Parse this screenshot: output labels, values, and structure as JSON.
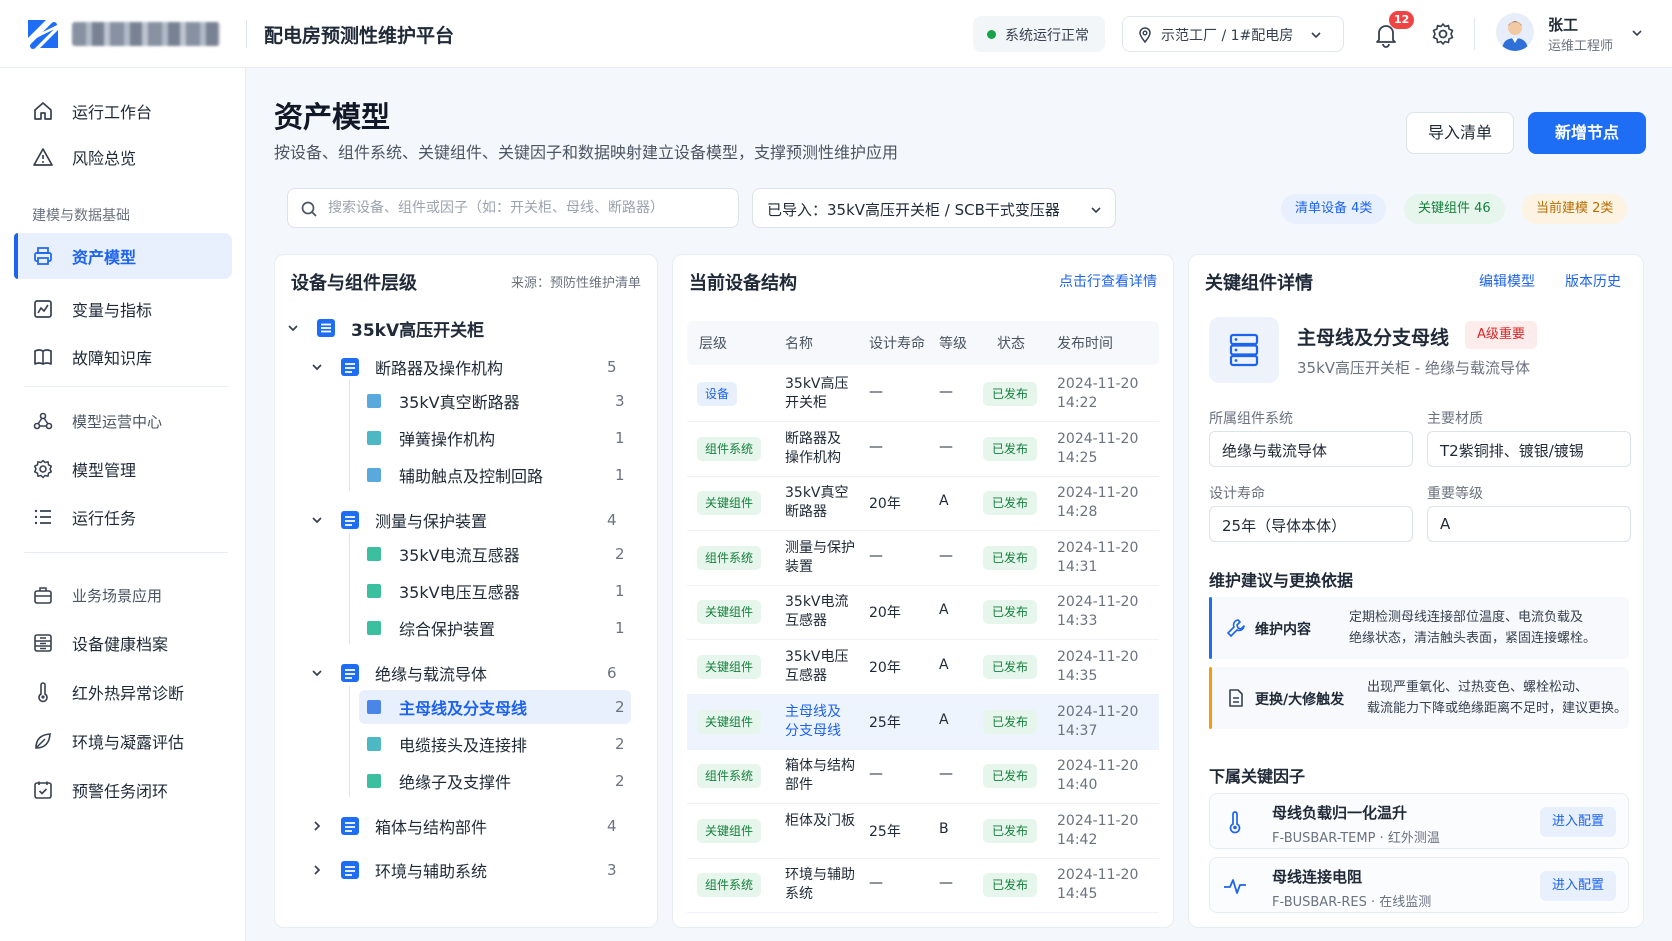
{
  "header": {
    "app_title": "配电房预测性维护平台",
    "system_status": "系统运行正常",
    "location": "示范工厂 / 1#配电房",
    "notifications": "12",
    "user_name": "张工",
    "user_role": "运维工程师"
  },
  "sidebar": {
    "items": [
      {
        "label": "运行工作台",
        "icon": "home-icon"
      },
      {
        "label": "风险总览",
        "icon": "warning-icon"
      },
      {
        "section": "建模与数据基础"
      },
      {
        "label": "资产模型",
        "icon": "printer-icon",
        "active": true
      },
      {
        "label": "变量与指标",
        "icon": "chart-icon"
      },
      {
        "label": "故障知识库",
        "icon": "book-icon"
      },
      {
        "section": "模型运营中心",
        "icon": "flow-icon"
      },
      {
        "label": "模型管理",
        "icon": "gear-icon"
      },
      {
        "label": "运行任务",
        "icon": "list-icon"
      },
      {
        "section": "业务场景应用",
        "icon": "briefcase-icon"
      },
      {
        "label": "设备健康档案",
        "icon": "archive-icon"
      },
      {
        "label": "红外热异常诊断",
        "icon": "thermometer-icon"
      },
      {
        "label": "环境与凝露评估",
        "icon": "leaf-icon"
      },
      {
        "label": "预警任务闭环",
        "icon": "calendar-check-icon"
      }
    ]
  },
  "page": {
    "title": "资产模型",
    "subtitle": "按设备、组件系统、关键组件、关键因子和数据映射建立设备模型，支撑预测性维护应用",
    "import_button": "导入清单",
    "add_button": "新增节点"
  },
  "filters": {
    "search_placeholder": "搜索设备、组件或因子（如：开关柜、母线、断路器）",
    "imported": "已导入：35kV高压开关柜 / SCB干式变压器",
    "chip_list": "清单设备 4类",
    "chip_key": "关键组件 46",
    "chip_model": "当前建模 2类"
  },
  "tree": {
    "title": "设备与组件层级",
    "source": "来源：预防性维护清单",
    "root": "35kV高压开关柜",
    "groups": [
      {
        "label": "断路器及操作机构",
        "count": "5",
        "expanded": true,
        "children": [
          {
            "label": "35kV真空断路器",
            "count": "3",
            "color": "#5aa9dd"
          },
          {
            "label": "弹簧操作机构",
            "count": "1",
            "color": "#4cb8c4"
          },
          {
            "label": "辅助触点及控制回路",
            "count": "1",
            "color": "#5aa9dd"
          }
        ]
      },
      {
        "label": "测量与保护装置",
        "count": "4",
        "expanded": true,
        "children": [
          {
            "label": "35kV电流互感器",
            "count": "2",
            "color": "#3cbf9e"
          },
          {
            "label": "35kV电压互感器",
            "count": "1",
            "color": "#3cbf9e"
          },
          {
            "label": "综合保护装置",
            "count": "1",
            "color": "#3cbf9e"
          }
        ]
      },
      {
        "label": "绝缘与载流导体",
        "count": "6",
        "expanded": true,
        "children": [
          {
            "label": "主母线及分支母线",
            "count": "2",
            "color": "#4a86e8",
            "selected": true
          },
          {
            "label": "电缆接头及连接排",
            "count": "2",
            "color": "#4cb8c4"
          },
          {
            "label": "绝缘子及支撑件",
            "count": "2",
            "color": "#3cbf9e"
          }
        ]
      },
      {
        "label": "箱体与结构部件",
        "count": "4",
        "expanded": false
      },
      {
        "label": "环境与辅助系统",
        "count": "3",
        "expanded": false
      }
    ]
  },
  "structure": {
    "title": "当前设备结构",
    "link": "点击行查看详情",
    "columns": [
      "层级",
      "名称",
      "设计寿命",
      "等级",
      "状态",
      "发布时间"
    ],
    "rows": [
      {
        "level": "设备",
        "kind": "dev",
        "name": [
          "35kV高压",
          "开关柜"
        ],
        "life": "—",
        "grade": "—",
        "status": "已发布",
        "date": "2024-11-20",
        "time": "14:22"
      },
      {
        "level": "组件系统",
        "kind": "sys",
        "name": [
          "断路器及",
          "操作机构"
        ],
        "life": "—",
        "grade": "—",
        "status": "已发布",
        "date": "2024-11-20",
        "time": "14:25"
      },
      {
        "level": "关键组件",
        "kind": "key",
        "name": [
          "35kV真空",
          "断路器"
        ],
        "life": "20年",
        "grade": "A",
        "status": "已发布",
        "date": "2024-11-20",
        "time": "14:28"
      },
      {
        "level": "组件系统",
        "kind": "sys",
        "name": [
          "测量与保护",
          "装置"
        ],
        "life": "—",
        "grade": "—",
        "status": "已发布",
        "date": "2024-11-20",
        "time": "14:31"
      },
      {
        "level": "关键组件",
        "kind": "key",
        "name": [
          "35kV电流",
          "互感器"
        ],
        "life": "20年",
        "grade": "A",
        "status": "已发布",
        "date": "2024-11-20",
        "time": "14:33"
      },
      {
        "level": "关键组件",
        "kind": "key",
        "name": [
          "35kV电压",
          "互感器"
        ],
        "life": "20年",
        "grade": "A",
        "status": "已发布",
        "date": "2024-11-20",
        "time": "14:35"
      },
      {
        "level": "关键组件",
        "kind": "key",
        "name": [
          "主母线及",
          "分支母线"
        ],
        "life": "25年",
        "grade": "A",
        "status": "已发布",
        "date": "2024-11-20",
        "time": "14:37",
        "selected": true
      },
      {
        "level": "组件系统",
        "kind": "sys",
        "name": [
          "箱体与结构",
          "部件"
        ],
        "life": "—",
        "grade": "—",
        "status": "已发布",
        "date": "2024-11-20",
        "time": "14:40"
      },
      {
        "level": "关键组件",
        "kind": "key",
        "name": [
          "柜体及门板",
          ""
        ],
        "life": "25年",
        "grade": "B",
        "status": "已发布",
        "date": "2024-11-20",
        "time": "14:42"
      },
      {
        "level": "组件系统",
        "kind": "sys",
        "name": [
          "环境与辅助",
          "系统"
        ],
        "life": "—",
        "grade": "—",
        "status": "已发布",
        "date": "2024-11-20",
        "time": "14:45"
      }
    ]
  },
  "detail": {
    "title": "关键组件详情",
    "edit_link": "编辑模型",
    "history_link": "版本历史",
    "component_name": "主母线及分支母线",
    "importance": "A级重要",
    "path": "35kV高压开关柜 - 绝缘与载流导体",
    "fields": {
      "system_label": "所属组件系统",
      "system_value": "绝缘与载流导体",
      "material_label": "主要材质",
      "material_value": "T2紫铜排、镀银/镀锡",
      "life_label": "设计寿命",
      "life_value": "25年（导体本体）",
      "grade_label": "重要等级",
      "grade_value": "A"
    },
    "advice_title": "维护建议与更换依据",
    "maintenance_title": "维护内容",
    "maintenance_lines": [
      "定期检测母线连接部位温度、电流负载及",
      "绝缘状态，清洁触头表面，紧固连接螺栓。"
    ],
    "replace_title": "更换/大修触发",
    "replace_lines": [
      "出现严重氧化、过热变色、螺栓松动、",
      "载流能力下降或绝缘距离不足时，建议更换。"
    ],
    "factors_title": "下属关键因子",
    "factors": [
      {
        "name": "母线负载归一化温升",
        "code": "F-BUSBAR-TEMP · 红外测温",
        "action": "进入配置",
        "icon": "thermometer-icon"
      },
      {
        "name": "母线连接电阻",
        "code": "F-BUSBAR-RES · 在线监测",
        "action": "进入配置",
        "icon": "pulse-icon"
      }
    ]
  },
  "colors": {
    "accent": "#1d6ef5",
    "success": "#16a34a",
    "danger": "#ef4444",
    "warning": "#f59e0b"
  }
}
